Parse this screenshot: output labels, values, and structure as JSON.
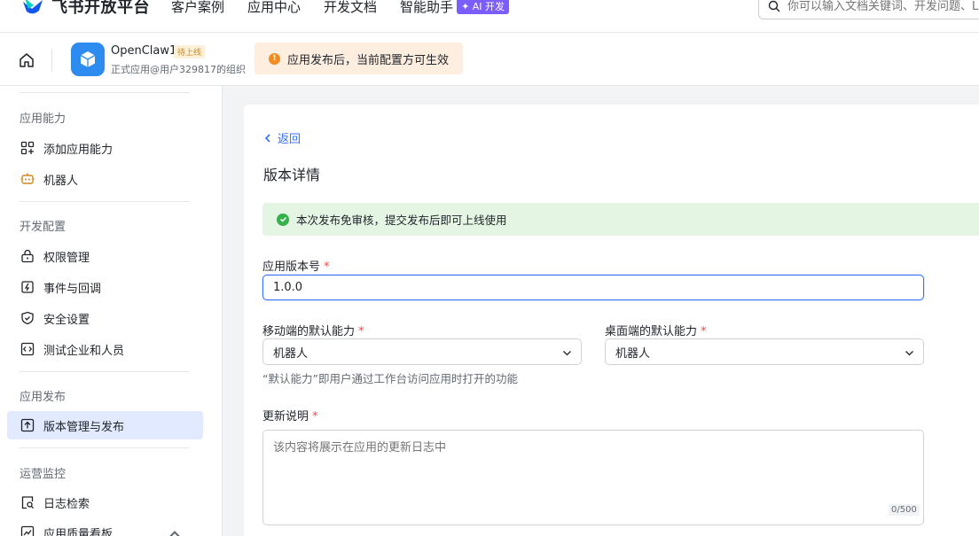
{
  "topnav": {
    "logo_text": "飞书开放平台",
    "items": [
      "客户案例",
      "应用中心",
      "开发文档",
      "智能助手"
    ],
    "ai_badge": "✦ AI 开发",
    "search_placeholder": "你可以输入文档关键词、开发问题、L"
  },
  "app": {
    "name": "OpenClaw1",
    "status": "待上线",
    "subtitle": "正式应用@用户329817的组织",
    "notice": "应用发布后，当前配置方可生效"
  },
  "sidebar": {
    "groups": [
      {
        "label": "应用能力",
        "items": [
          "添加应用能力",
          "机器人"
        ]
      },
      {
        "label": "开发配置",
        "items": [
          "权限管理",
          "事件与回调",
          "安全设置",
          "测试企业和人员"
        ]
      },
      {
        "label": "应用发布",
        "items": [
          "版本管理与发布"
        ]
      },
      {
        "label": "运营监控",
        "items": [
          "日志检索",
          "应用质量看板"
        ]
      }
    ]
  },
  "main": {
    "back": "返回",
    "title": "版本详情",
    "success": "本次发布免审核，提交发布后即可上线使用",
    "version_label": "应用版本号",
    "version_value": "1.0.0",
    "mobile_label": "移动端的默认能力",
    "mobile_value": "机器人",
    "desktop_label": "桌面端的默认能力",
    "desktop_value": "机器人",
    "hint": "“默认能力”即用户通过工作台访问应用时打开的功能",
    "notes_label": "更新说明",
    "notes_placeholder": "该内容将展示在应用的更新日志中",
    "notes_counter": "0/500",
    "required_mark": "*"
  },
  "colors": {
    "accent": "#3370ff",
    "success": "#34b14b",
    "warning": "#f18b22"
  }
}
